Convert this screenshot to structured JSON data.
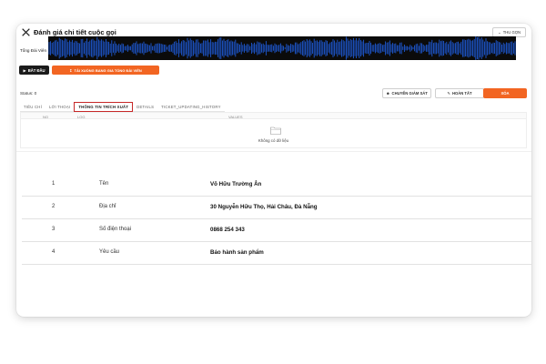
{
  "header": {
    "title": "Đánh giá chi tiết cuộc gọi",
    "collapse_label": "THU GỌN"
  },
  "audio": {
    "channel_label": "Tổng Đài Viên",
    "waveform_color": "#1e5bd7"
  },
  "controls": {
    "play_label": "BẮT ĐẦU",
    "download_label": "TẢI XUỐNG BANG GIA TỔNG ĐÀI VIÊN"
  },
  "status": {
    "text": "Status: 0"
  },
  "actions": {
    "transfer_label": "CHUYỂN GIÁM SÁT",
    "done_label": "HOÀN TẤT",
    "delete_label": "XÓA",
    "accent_color": "#f26522"
  },
  "tabs": [
    {
      "label": "TIÊU CHÍ",
      "active": false
    },
    {
      "label": "LỜI THOẠI",
      "active": false
    },
    {
      "label": "THÔNG TIN TRÍCH XUẤT",
      "active": true
    },
    {
      "label": "DETAILS",
      "active": false
    },
    {
      "label": "TICKET_UPDATING_HISTORY",
      "active": false
    }
  ],
  "subtable": {
    "columns": [
      "NO",
      "LOG",
      "VALUES"
    ],
    "empty_text": "Không có dữ liệu"
  },
  "extracted": [
    {
      "no": "1",
      "label": "Tên",
      "value": "Võ Hữu Trường Ân"
    },
    {
      "no": "2",
      "label": "Địa chỉ",
      "value": "30 Nguyễn Hữu Thọ, Hải Châu, Đà Nẵng"
    },
    {
      "no": "3",
      "label": "Số điện thoại",
      "value": "0868 254 343"
    },
    {
      "no": "4",
      "label": "Yêu cầu",
      "value": "Báo hành sản phẩm"
    }
  ]
}
